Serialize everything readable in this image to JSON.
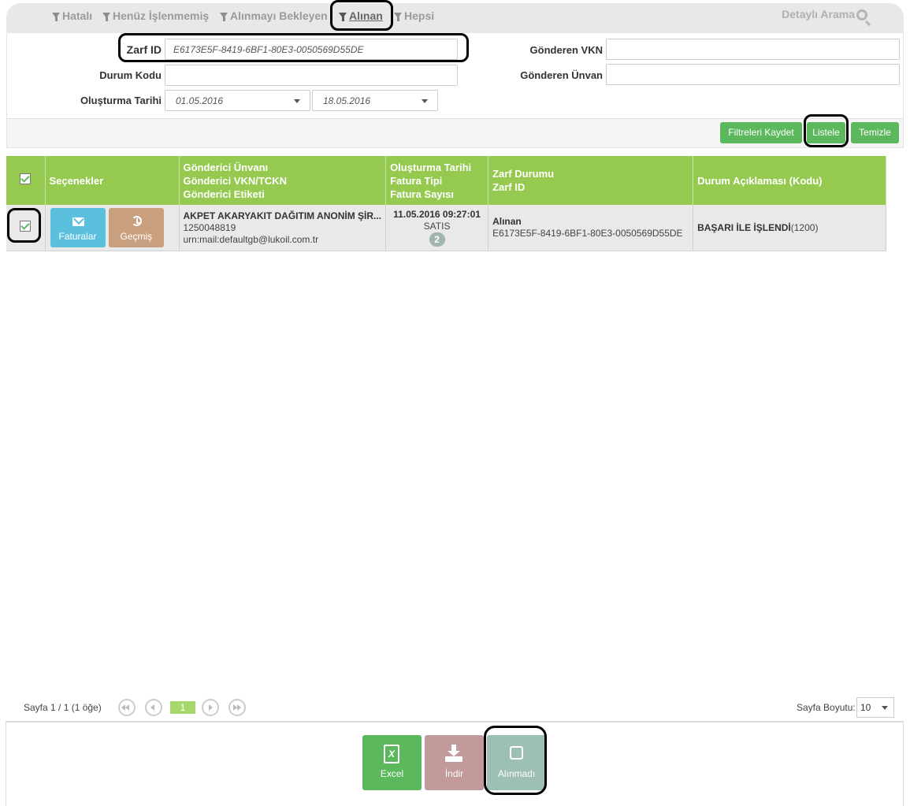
{
  "tabs": [
    {
      "label": "Hatalı",
      "active": false
    },
    {
      "label": "Henüz İşlenmemiş",
      "active": false
    },
    {
      "label": "Alınmayı Bekleyen",
      "active": false
    },
    {
      "label": "Alınan",
      "active": true
    },
    {
      "label": "Hepsi",
      "active": false
    }
  ],
  "detailed_search": "Detaylı Arama",
  "form": {
    "zarf_id_label": "Zarf ID",
    "zarf_id_value": "E6173E5F-8419-6BF1-80E3-0050569D55DE",
    "durum_kodu_label": "Durum Kodu",
    "durum_kodu_value": "",
    "olusturma_label": "Oluşturma Tarihi",
    "date_from": "01.05.2016",
    "date_to": "18.05.2016",
    "gonderen_vkn_label": "Gönderen VKN",
    "gonderen_vkn_value": "",
    "gonderen_unvan_label": "Gönderen Ünvan",
    "gonderen_unvan_value": ""
  },
  "actions": {
    "save_filters": "Filtreleri Kaydet",
    "list": "Listele",
    "clear": "Temizle"
  },
  "table": {
    "headers": {
      "options": "Seçenekler",
      "sender_1": "Gönderici Ünvanı",
      "sender_2": "Gönderici VKN/TCKN",
      "sender_3": "Gönderici Etiketi",
      "date_1": "Oluşturma Tarihi",
      "date_2": "Fatura Tipi",
      "date_3": "Fatura Sayısı",
      "env_1": "Zarf Durumu",
      "env_2": "Zarf ID",
      "status": "Durum Açıklaması (Kodu)"
    },
    "rows": [
      {
        "checked": true,
        "btn_invoices": "Faturalar",
        "btn_history": "Geçmiş",
        "sender_title": "AKPET AKARYAKIT DAĞITIM ANONİM ŞİR...",
        "sender_vkn": "1250048819",
        "sender_tag": "urn:mail:defaultgb@lukoil.com.tr",
        "created": "11.05.2016 09:27:01",
        "invoice_type": "SATIS",
        "invoice_count": "2",
        "envelope_status": "Alınan",
        "envelope_id": "E6173E5F-8419-6BF1-80E3-0050569D55DE",
        "status_desc": "BAŞARI İLE İŞLENDİ",
        "status_code": "(1200)"
      }
    ]
  },
  "pager": {
    "summary": "Sayfa 1 / 1 (1 öğe)",
    "current_page": "1",
    "page_size_label": "Sayfa Boyutu:",
    "page_size": "10"
  },
  "bottom": {
    "excel": "Excel",
    "download": "İndir",
    "not_received": "Alınmadı"
  },
  "colors": {
    "header_green": "#95c94f",
    "button_green": "#5cb85c",
    "info_blue": "#5bc0de",
    "history_brown": "#c9a07f",
    "download_rose": "#c29a9a",
    "not_received_teal": "#9dbfb5"
  }
}
